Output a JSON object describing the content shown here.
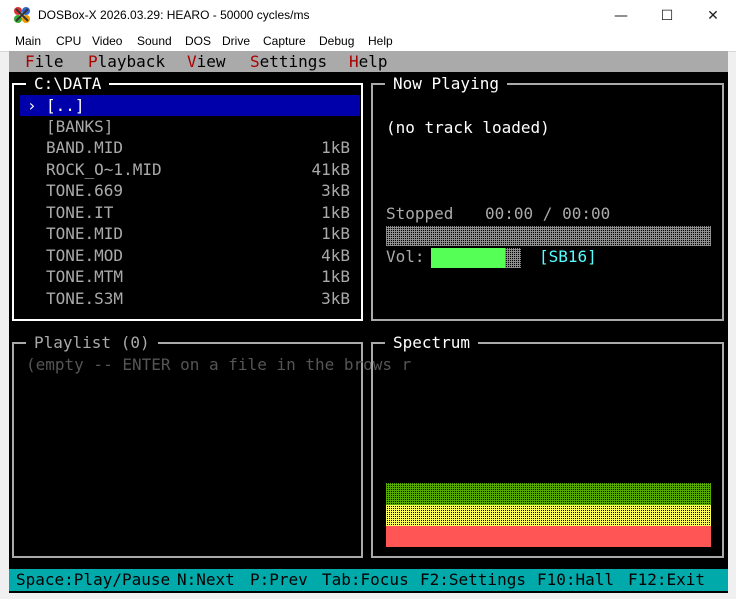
{
  "window": {
    "title": "DOSBox-X 2026.03.29: HEARO - 50000 cycles/ms",
    "icon": "dosbox-icon",
    "controls": {
      "minimize": "—",
      "maximize": "☐",
      "close": "✕"
    }
  },
  "host_menu": [
    "Main",
    "CPU",
    "Video",
    "Sound",
    "DOS",
    "Drive",
    "Capture",
    "Debug",
    "Help"
  ],
  "app_menu": [
    {
      "hot": "F",
      "rest": "ile"
    },
    {
      "hot": "P",
      "rest": "layback"
    },
    {
      "hot": "V",
      "rest": "iew"
    },
    {
      "hot": "S",
      "rest": "ettings"
    },
    {
      "hot": "H",
      "rest": "elp"
    }
  ],
  "browser": {
    "title": "C:\\DATA",
    "caret": "›",
    "items": [
      {
        "name": "[..]",
        "size": "",
        "selected": true
      },
      {
        "name": "[BANKS]",
        "size": ""
      },
      {
        "name": "BAND.MID",
        "size": "1kB"
      },
      {
        "name": "ROCK_O~1.MID",
        "size": "41kB"
      },
      {
        "name": "TONE.669",
        "size": "3kB"
      },
      {
        "name": "TONE.IT",
        "size": "1kB"
      },
      {
        "name": "TONE.MID",
        "size": "1kB"
      },
      {
        "name": "TONE.MOD",
        "size": "4kB"
      },
      {
        "name": "TONE.MTM",
        "size": "1kB"
      },
      {
        "name": "TONE.S3M",
        "size": "3kB"
      }
    ]
  },
  "now_playing": {
    "title": "Now Playing",
    "track": "(no track loaded)",
    "state": "Stopped",
    "time": "00:00 / 00:00",
    "progress": 0.0,
    "vol_label": "Vol:",
    "volume": 0.82,
    "device": "[SB16]"
  },
  "playlist": {
    "title": "Playlist (0)",
    "empty_hint": "(empty -- ENTER on a file in the brows r"
  },
  "spectrum": {
    "title": "Spectrum",
    "colors": {
      "top": "#55aa00",
      "mid": "#ffff55",
      "base": "#ff5555"
    }
  },
  "status_bar": [
    "Space:Play/Pause",
    "N:Next",
    "P:Prev",
    "Tab:Focus",
    "F2:Settings",
    "F10:Hall",
    "F12:Exit"
  ]
}
